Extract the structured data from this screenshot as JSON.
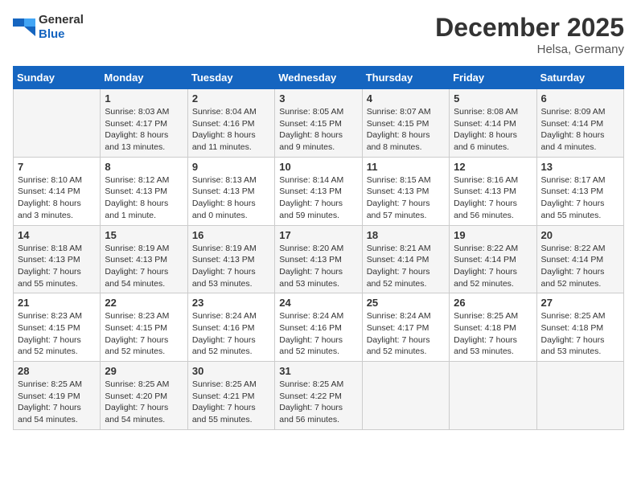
{
  "header": {
    "logo_general": "General",
    "logo_blue": "Blue",
    "title": "December 2025",
    "location": "Helsa, Germany"
  },
  "columns": [
    "Sunday",
    "Monday",
    "Tuesday",
    "Wednesday",
    "Thursday",
    "Friday",
    "Saturday"
  ],
  "weeks": [
    [
      {
        "day": "",
        "sunrise": "",
        "sunset": "",
        "daylight": ""
      },
      {
        "day": "1",
        "sunrise": "Sunrise: 8:03 AM",
        "sunset": "Sunset: 4:17 PM",
        "daylight": "Daylight: 8 hours and 13 minutes."
      },
      {
        "day": "2",
        "sunrise": "Sunrise: 8:04 AM",
        "sunset": "Sunset: 4:16 PM",
        "daylight": "Daylight: 8 hours and 11 minutes."
      },
      {
        "day": "3",
        "sunrise": "Sunrise: 8:05 AM",
        "sunset": "Sunset: 4:15 PM",
        "daylight": "Daylight: 8 hours and 9 minutes."
      },
      {
        "day": "4",
        "sunrise": "Sunrise: 8:07 AM",
        "sunset": "Sunset: 4:15 PM",
        "daylight": "Daylight: 8 hours and 8 minutes."
      },
      {
        "day": "5",
        "sunrise": "Sunrise: 8:08 AM",
        "sunset": "Sunset: 4:14 PM",
        "daylight": "Daylight: 8 hours and 6 minutes."
      },
      {
        "day": "6",
        "sunrise": "Sunrise: 8:09 AM",
        "sunset": "Sunset: 4:14 PM",
        "daylight": "Daylight: 8 hours and 4 minutes."
      }
    ],
    [
      {
        "day": "7",
        "sunrise": "Sunrise: 8:10 AM",
        "sunset": "Sunset: 4:14 PM",
        "daylight": "Daylight: 8 hours and 3 minutes."
      },
      {
        "day": "8",
        "sunrise": "Sunrise: 8:12 AM",
        "sunset": "Sunset: 4:13 PM",
        "daylight": "Daylight: 8 hours and 1 minute."
      },
      {
        "day": "9",
        "sunrise": "Sunrise: 8:13 AM",
        "sunset": "Sunset: 4:13 PM",
        "daylight": "Daylight: 8 hours and 0 minutes."
      },
      {
        "day": "10",
        "sunrise": "Sunrise: 8:14 AM",
        "sunset": "Sunset: 4:13 PM",
        "daylight": "Daylight: 7 hours and 59 minutes."
      },
      {
        "day": "11",
        "sunrise": "Sunrise: 8:15 AM",
        "sunset": "Sunset: 4:13 PM",
        "daylight": "Daylight: 7 hours and 57 minutes."
      },
      {
        "day": "12",
        "sunrise": "Sunrise: 8:16 AM",
        "sunset": "Sunset: 4:13 PM",
        "daylight": "Daylight: 7 hours and 56 minutes."
      },
      {
        "day": "13",
        "sunrise": "Sunrise: 8:17 AM",
        "sunset": "Sunset: 4:13 PM",
        "daylight": "Daylight: 7 hours and 55 minutes."
      }
    ],
    [
      {
        "day": "14",
        "sunrise": "Sunrise: 8:18 AM",
        "sunset": "Sunset: 4:13 PM",
        "daylight": "Daylight: 7 hours and 55 minutes."
      },
      {
        "day": "15",
        "sunrise": "Sunrise: 8:19 AM",
        "sunset": "Sunset: 4:13 PM",
        "daylight": "Daylight: 7 hours and 54 minutes."
      },
      {
        "day": "16",
        "sunrise": "Sunrise: 8:19 AM",
        "sunset": "Sunset: 4:13 PM",
        "daylight": "Daylight: 7 hours and 53 minutes."
      },
      {
        "day": "17",
        "sunrise": "Sunrise: 8:20 AM",
        "sunset": "Sunset: 4:13 PM",
        "daylight": "Daylight: 7 hours and 53 minutes."
      },
      {
        "day": "18",
        "sunrise": "Sunrise: 8:21 AM",
        "sunset": "Sunset: 4:14 PM",
        "daylight": "Daylight: 7 hours and 52 minutes."
      },
      {
        "day": "19",
        "sunrise": "Sunrise: 8:22 AM",
        "sunset": "Sunset: 4:14 PM",
        "daylight": "Daylight: 7 hours and 52 minutes."
      },
      {
        "day": "20",
        "sunrise": "Sunrise: 8:22 AM",
        "sunset": "Sunset: 4:14 PM",
        "daylight": "Daylight: 7 hours and 52 minutes."
      }
    ],
    [
      {
        "day": "21",
        "sunrise": "Sunrise: 8:23 AM",
        "sunset": "Sunset: 4:15 PM",
        "daylight": "Daylight: 7 hours and 52 minutes."
      },
      {
        "day": "22",
        "sunrise": "Sunrise: 8:23 AM",
        "sunset": "Sunset: 4:15 PM",
        "daylight": "Daylight: 7 hours and 52 minutes."
      },
      {
        "day": "23",
        "sunrise": "Sunrise: 8:24 AM",
        "sunset": "Sunset: 4:16 PM",
        "daylight": "Daylight: 7 hours and 52 minutes."
      },
      {
        "day": "24",
        "sunrise": "Sunrise: 8:24 AM",
        "sunset": "Sunset: 4:16 PM",
        "daylight": "Daylight: 7 hours and 52 minutes."
      },
      {
        "day": "25",
        "sunrise": "Sunrise: 8:24 AM",
        "sunset": "Sunset: 4:17 PM",
        "daylight": "Daylight: 7 hours and 52 minutes."
      },
      {
        "day": "26",
        "sunrise": "Sunrise: 8:25 AM",
        "sunset": "Sunset: 4:18 PM",
        "daylight": "Daylight: 7 hours and 53 minutes."
      },
      {
        "day": "27",
        "sunrise": "Sunrise: 8:25 AM",
        "sunset": "Sunset: 4:18 PM",
        "daylight": "Daylight: 7 hours and 53 minutes."
      }
    ],
    [
      {
        "day": "28",
        "sunrise": "Sunrise: 8:25 AM",
        "sunset": "Sunset: 4:19 PM",
        "daylight": "Daylight: 7 hours and 54 minutes."
      },
      {
        "day": "29",
        "sunrise": "Sunrise: 8:25 AM",
        "sunset": "Sunset: 4:20 PM",
        "daylight": "Daylight: 7 hours and 54 minutes."
      },
      {
        "day": "30",
        "sunrise": "Sunrise: 8:25 AM",
        "sunset": "Sunset: 4:21 PM",
        "daylight": "Daylight: 7 hours and 55 minutes."
      },
      {
        "day": "31",
        "sunrise": "Sunrise: 8:25 AM",
        "sunset": "Sunset: 4:22 PM",
        "daylight": "Daylight: 7 hours and 56 minutes."
      },
      {
        "day": "",
        "sunrise": "",
        "sunset": "",
        "daylight": ""
      },
      {
        "day": "",
        "sunrise": "",
        "sunset": "",
        "daylight": ""
      },
      {
        "day": "",
        "sunrise": "",
        "sunset": "",
        "daylight": ""
      }
    ]
  ]
}
